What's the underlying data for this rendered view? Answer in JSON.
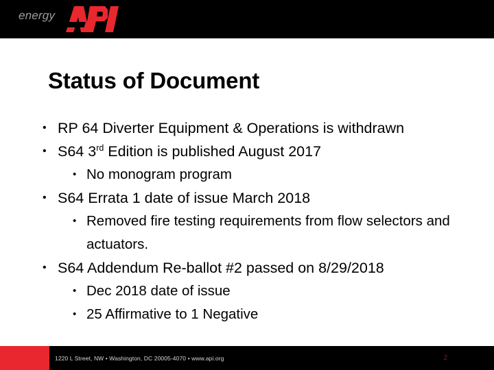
{
  "header": {
    "logo": {
      "energy_word": "energy",
      "brand_word": "API",
      "brand_color": "#e8282e",
      "energy_color": "#9a9a9a",
      "band_color": "#000000"
    }
  },
  "slide": {
    "title": "Status of Document",
    "bullets": [
      {
        "level": 1,
        "marker": "•",
        "text": "RP 64 Diverter Equipment & Operations is withdrawn"
      },
      {
        "level": 1,
        "marker": "•",
        "text_before": "S64 3",
        "ordinal": "rd",
        "text_after": " Edition is published August 2017"
      },
      {
        "level": 2,
        "marker": "•",
        "text": "No monogram program"
      },
      {
        "level": 1,
        "marker": "•",
        "text": "S64 Errata 1 date of issue March 2018"
      },
      {
        "level": 2,
        "marker": "•",
        "text": "Removed fire testing requirements from flow selectors and actuators."
      },
      {
        "level": 1,
        "marker": "•",
        "text": "S64 Addendum Re-ballot #2 passed on 8/29/2018"
      },
      {
        "level": 2,
        "marker": "•",
        "text": "Dec 2018 date of issue"
      },
      {
        "level": 2,
        "marker": "•",
        "text": "25 Affirmative to 1 Negative"
      }
    ]
  },
  "footer": {
    "address_line": "1220 L Street, NW  •  Washington, DC 20005-4070  •  www.api.org",
    "page_number": "2",
    "accent_color": "#e8282e",
    "band_color": "#000000"
  }
}
